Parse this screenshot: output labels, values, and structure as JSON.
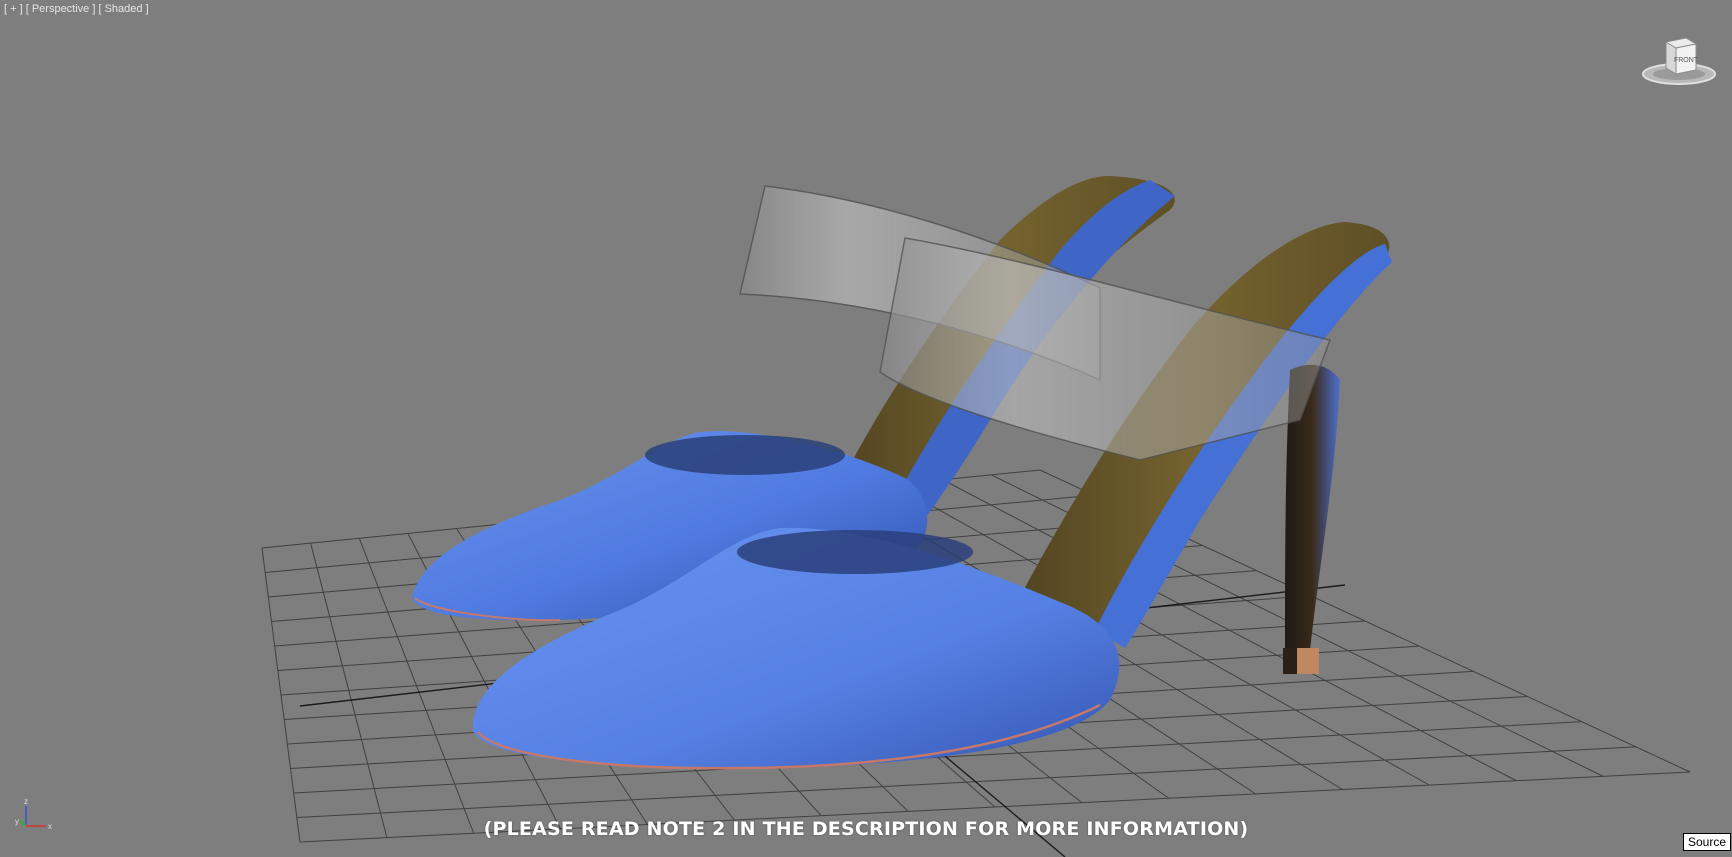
{
  "viewport": {
    "label_plus": "[ + ]",
    "label_view": "[ Perspective ]",
    "label_shading": "[ Shaded ]",
    "background_color": "#7e7e7e",
    "grid_color": "#2e2e2e"
  },
  "viewcube": {
    "face_label": "FRONT",
    "icon": "viewcube-icon"
  },
  "axis": {
    "z": "z",
    "x": "x",
    "y": "y"
  },
  "note_text": "(PLEASE READ NOTE 2 IN THE DESCRIPTION FOR MORE INFORMATION)",
  "source_button_label": "Source",
  "model": {
    "shoe_color": "#5580e0",
    "insole_color": "#6e5c2e",
    "strap_color": "#b0b0b0",
    "heel_tip_color": "#c08860"
  }
}
